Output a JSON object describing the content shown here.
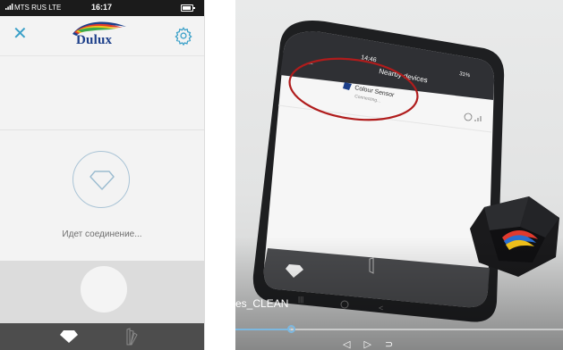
{
  "status_bar": {
    "carrier": "MTS RUS  LTE",
    "time": "16:17"
  },
  "app": {
    "logo_text": "Dulux",
    "connecting_text": "Идет соединение..."
  },
  "video": {
    "screen_title": "Nearby devices",
    "device_name": "Colour Sensor",
    "device_status": "Connecting...",
    "status_time": "14:46",
    "battery_text": "31%",
    "caption": "es_CLEAN",
    "progress": 0.17,
    "play_controls": "◁ ▷ ⊃"
  },
  "colors": {
    "accent": "#3aa0c8",
    "logo_blue": "#1c3f8a",
    "annotation_red": "#b01c1c",
    "tabbar": "#4d4d4d",
    "progress": "#7cb8e0"
  }
}
